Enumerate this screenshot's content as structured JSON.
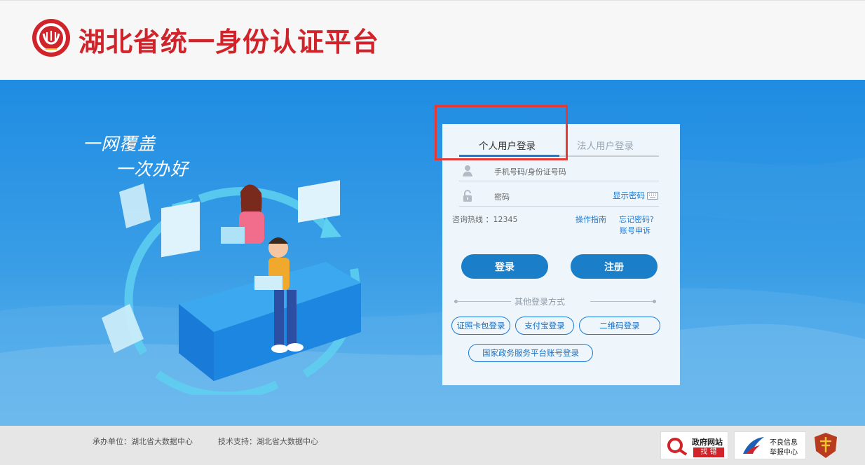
{
  "header": {
    "title": "湖北省统一身份认证平台",
    "logo_icon": "hubei-emblem-logo"
  },
  "hero": {
    "slogan_line1": "一网覆盖",
    "slogan_line2": "一次办好"
  },
  "login": {
    "tabs": [
      {
        "label": "个人用户登录",
        "active": true
      },
      {
        "label": "法人用户登录",
        "active": false
      }
    ],
    "username_placeholder": "手机号码/身份证号码",
    "password_placeholder": "密码",
    "show_password_label": "显示密码",
    "hotline": "咨询热线 ：12345",
    "guide_link": "操作指南",
    "forgot_link": "忘记密码?",
    "appeal_link": "账号申诉",
    "login_button": "登录",
    "register_button": "注册",
    "other_methods_label": "其他登录方式",
    "methods": [
      {
        "label": "证照卡包登录"
      },
      {
        "label": "支付宝登录"
      },
      {
        "label": "二维码登录"
      },
      {
        "label": "国家政务服务平台账号登录"
      }
    ]
  },
  "footer": {
    "organizer": "承办单位：湖北省大数据中心",
    "support": "技术支持：湖北省大数据中心",
    "badges": {
      "gov_line1": "政府网站",
      "gov_line2": "找 错",
      "report_line1": "不良信息",
      "report_line2": "举报中心"
    }
  },
  "colors": {
    "brand_red": "#d0232a",
    "primary_blue": "#1a7ec9",
    "hero_blue": "#1f8ce2",
    "highlight": "#e53935"
  }
}
